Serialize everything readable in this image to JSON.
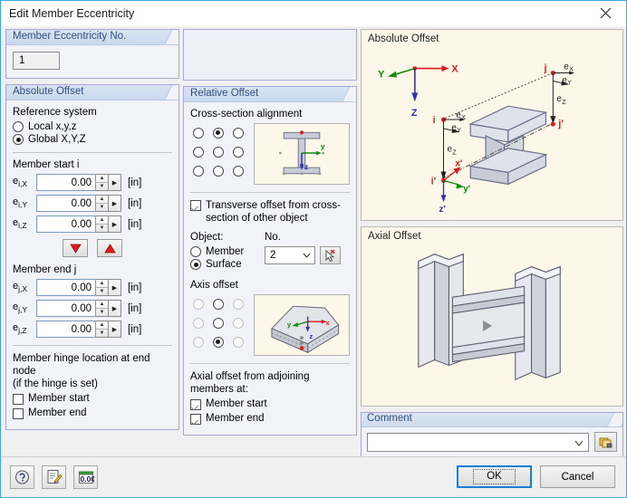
{
  "window": {
    "title": "Edit Member Eccentricity",
    "close_icon": "close-icon"
  },
  "eccentricity_no": {
    "header": "Member Eccentricity No.",
    "value": "1"
  },
  "absolute_offset": {
    "header": "Absolute Offset",
    "reference_system_label": "Reference system",
    "options": [
      {
        "label": "Local x,y,z",
        "checked": false
      },
      {
        "label": "Global X,Y,Z",
        "checked": true
      }
    ],
    "member_start_label": "Member start i",
    "start_fields": [
      {
        "label": "ei,X",
        "sub_main": "e",
        "sub_idx": "i,X",
        "value": "0.00",
        "unit": "[in]"
      },
      {
        "label": "ei,Y",
        "sub_main": "e",
        "sub_idx": "i,Y",
        "value": "0.00",
        "unit": "[in]"
      },
      {
        "label": "ei,Z",
        "sub_main": "e",
        "sub_idx": "i,Z",
        "value": "0.00",
        "unit": "[in]"
      }
    ],
    "copy_down_icon": "red-triangle-down-icon",
    "copy_up_icon": "red-triangle-up-icon",
    "member_end_label": "Member end j",
    "end_fields": [
      {
        "label": "ej,X",
        "sub_main": "e",
        "sub_idx": "j,X",
        "value": "0.00",
        "unit": "[in]"
      },
      {
        "label": "ej,Y",
        "sub_main": "e",
        "sub_idx": "j,Y",
        "value": "0.00",
        "unit": "[in]"
      },
      {
        "label": "ej,Z",
        "sub_main": "e",
        "sub_idx": "j,Z",
        "value": "0.00",
        "unit": "[in]"
      }
    ],
    "hinge_label_line1": "Member hinge location at end node",
    "hinge_label_line2": "(if the hinge is set)",
    "hinge_options": [
      {
        "label": "Member start",
        "checked": false
      },
      {
        "label": "Member end",
        "checked": false
      }
    ]
  },
  "relative_offset": {
    "header": "Relative Offset",
    "cross_section_alignment_label": "Cross-section alignment",
    "alignment_grid": [
      {
        "checked": false,
        "disabled": false
      },
      {
        "checked": true,
        "disabled": false
      },
      {
        "checked": false,
        "disabled": false
      },
      {
        "checked": false,
        "disabled": false
      },
      {
        "checked": false,
        "disabled": false
      },
      {
        "checked": false,
        "disabled": false
      },
      {
        "checked": false,
        "disabled": false
      },
      {
        "checked": false,
        "disabled": false
      },
      {
        "checked": false,
        "disabled": false
      }
    ],
    "transverse_offset": {
      "label_line1": "Transverse offset from cross-",
      "label_line2": "section of other object",
      "checked": true
    },
    "object_label": "Object:",
    "no_label": "No.",
    "object_options": [
      {
        "label": "Member",
        "checked": false
      },
      {
        "label": "Surface",
        "checked": true
      }
    ],
    "object_no_value": "2",
    "pick_icon": "pick-object-cursor-icon",
    "axis_offset_label": "Axis offset",
    "axis_grid": [
      {
        "checked": false,
        "disabled": true
      },
      {
        "checked": false,
        "disabled": false
      },
      {
        "checked": false,
        "disabled": true
      },
      {
        "checked": false,
        "disabled": true
      },
      {
        "checked": false,
        "disabled": false
      },
      {
        "checked": false,
        "disabled": true
      },
      {
        "checked": false,
        "disabled": true
      },
      {
        "checked": true,
        "disabled": false
      },
      {
        "checked": false,
        "disabled": true
      }
    ],
    "axial_offset_label_line1": "Axial offset from adjoining",
    "axial_offset_label_line2": "members at:",
    "axial_options": [
      {
        "label": "Member start",
        "checked": true
      },
      {
        "label": "Member end",
        "checked": true
      }
    ]
  },
  "preview": {
    "absolute_offset_caption": "Absolute Offset",
    "axial_offset_caption": "Axial Offset",
    "abs_labels": {
      "X": "X",
      "Y": "Y",
      "Z": "Z",
      "i": "i",
      "j": "j",
      "ip": "i'",
      "jp": "j'",
      "eX": "eX",
      "eY": "eY",
      "eZ": "eZ",
      "xp": "x'",
      "yp": "y'",
      "zp": "z'"
    },
    "cross_section_labels": {
      "y": "y",
      "z": "z"
    },
    "surface_labels": {
      "x": "x",
      "y": "y",
      "z": "z"
    }
  },
  "comment": {
    "header": "Comment",
    "value": "",
    "placeholder": "",
    "browse_icon": "comment-library-icon",
    "chevron_icon": "chevron-down-icon"
  },
  "footer": {
    "help_icon": "help-question-icon",
    "edit_icon": "edit-pencil-icon",
    "units_icon": "units-decimal-places-icon",
    "ok_label": "OK",
    "cancel_label": "Cancel"
  },
  "colors": {
    "accent": "#3ba7e8",
    "group_border": "#a9a5d6",
    "header_text": "#2f4f7f",
    "preview_bg": "#fdf7ea",
    "axis_x": "#e03030",
    "axis_y": "#108a10",
    "axis_z": "#3030b0"
  }
}
